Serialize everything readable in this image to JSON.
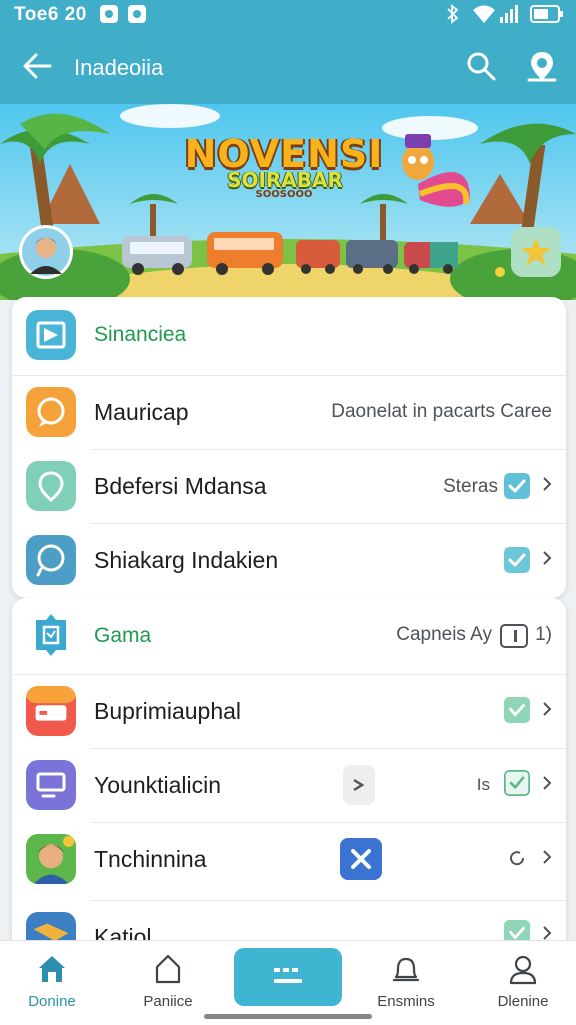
{
  "status_bar": {
    "time": "Toe6 20"
  },
  "app_bar": {
    "title": "Inadeoiia"
  },
  "banner": {
    "title": "NOVENSI",
    "subtitle": "SOIRABAR",
    "tagline": "SOOSOOO"
  },
  "card1": {
    "section_label": "Sinanciea",
    "rows": [
      {
        "label": "Mauricap",
        "meta": "Daonelat in pacarts Caree"
      },
      {
        "label": "Bdefersi Mdansa",
        "meta": "Steras"
      },
      {
        "label": "Shiakarg Indakien"
      }
    ]
  },
  "card2": {
    "section_label": "Gama",
    "section_meta": "Capneis Ay",
    "section_meta2": "1)",
    "rows": [
      {
        "label": "Buprimiauphal"
      },
      {
        "label": "Younktialicin",
        "meta": "Is"
      },
      {
        "label": "Tnchinnina"
      },
      {
        "label": "Katiol"
      }
    ]
  },
  "bottom_nav": [
    {
      "label": "Donine",
      "icon": "home-icon"
    },
    {
      "label": "Paniice",
      "icon": "bookmark-icon"
    },
    {
      "label": "",
      "icon": "menu-icon"
    },
    {
      "label": "Ensmins",
      "icon": "bell-icon"
    },
    {
      "label": "Dlenine",
      "icon": "profile-icon"
    }
  ],
  "colors": {
    "accent": "#40aec9",
    "section_green": "#1f9a52",
    "check_teal": "#6cc7d8"
  }
}
